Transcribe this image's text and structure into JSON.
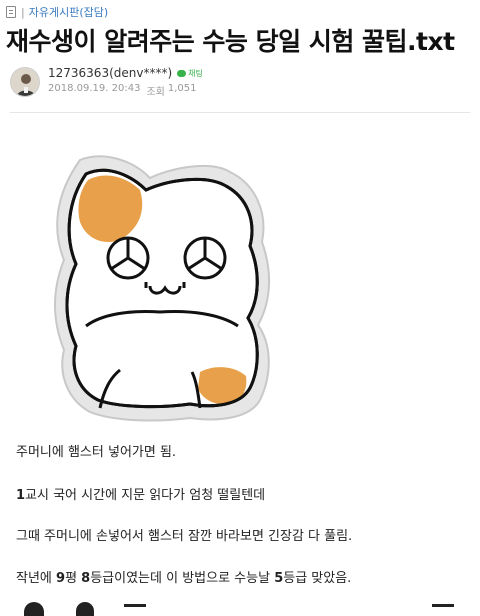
{
  "board": {
    "name": "자유게시판(잡담)",
    "separator": "|"
  },
  "post": {
    "title": "재수생이 알려주는 수능 당일 시험 꿀팁.txt",
    "author": "12736363(denv****)",
    "chat_label": "채팅",
    "date": "2018.09.19. 20:43",
    "views_label": "조회",
    "views": "1,051"
  },
  "content": {
    "line1": "주머니에 햄스터 넣어가면 됨.",
    "line2_bold": "1",
    "line2_rest": "교시 국어 시간에 지문 읽다가 엄청 떨릴텐데",
    "line3": "그때 주머니에 손넣어서 햄스터 잠깐 바라보면 긴장감 다 풀림.",
    "line4_a": "작년에 ",
    "line4_b": "9",
    "line4_c": "평 ",
    "line4_d": "8",
    "line4_e": "등급이였는데 이 방법으로 수능날 ",
    "line4_f": "5",
    "line4_g": "등급 맞았음."
  },
  "icons": {
    "doc": "document-icon",
    "chat": "chat-bubble-icon",
    "image": "hamster-illustration",
    "avatar": "avatar"
  },
  "colors": {
    "link_blue": "#3b7bbf",
    "chat_green": "#36b24a",
    "hamster_orange": "#e8a14a"
  }
}
